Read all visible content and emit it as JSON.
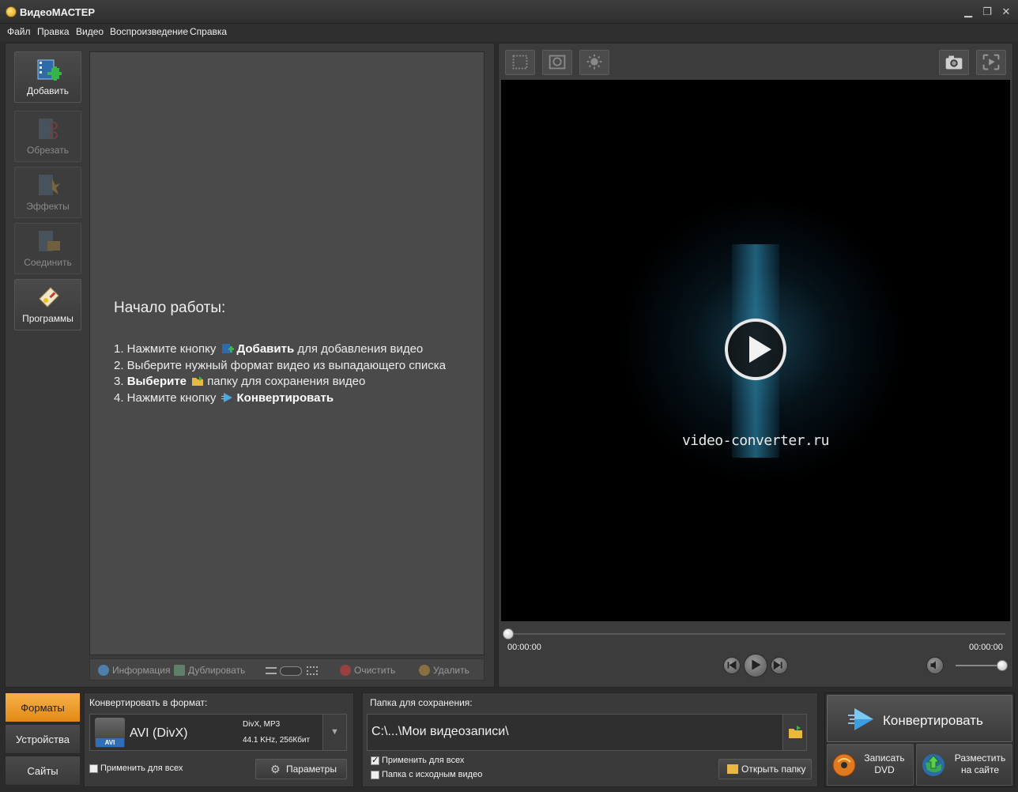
{
  "window": {
    "title": "ВидеоМАСТЕР",
    "min": "▁",
    "restore": "❐",
    "close": "✕"
  },
  "menu": [
    "Файл",
    "Правка",
    "Видео",
    "Воспроизведение",
    "Справка"
  ],
  "tools": [
    {
      "label": "Добавить",
      "enabled": true,
      "icon": "film-add-icon"
    },
    {
      "label": "Обрезать",
      "enabled": false,
      "icon": "scissors-icon"
    },
    {
      "label": "Эффекты",
      "enabled": false,
      "icon": "effects-icon"
    },
    {
      "label": "Соединить",
      "enabled": false,
      "icon": "join-icon"
    },
    {
      "label": "Программы",
      "enabled": true,
      "icon": "programs-icon"
    }
  ],
  "guide": {
    "title": "Начало работы:",
    "step1_pre": "1. Нажмите кнопку",
    "step1_bold": "Добавить",
    "step1_post": "для добавления видео",
    "step2": "2. Выберите нужный формат видео из выпадающего списка",
    "step3_pre": "3.",
    "step3_bold": "Выберите",
    "step3_post": "папку для сохранения видео",
    "step4_pre": "4. Нажмите кнопку",
    "step4_bold": "Конвертировать"
  },
  "listbar": {
    "info": "Информация",
    "duplicate": "Дублировать",
    "clear": "Очистить",
    "delete": "Удалить"
  },
  "preview": {
    "brand": "video-converter.ru",
    "time_start": "00:00:00",
    "time_end": "00:00:00",
    "progress": 0,
    "volume": 1.0
  },
  "tabs": [
    {
      "label": "Форматы",
      "active": true
    },
    {
      "label": "Устройства",
      "active": false
    },
    {
      "label": "Сайты",
      "active": false
    }
  ],
  "format": {
    "header": "Конвертировать в формат:",
    "badge": "AVI",
    "name": "AVI (DivX)",
    "spec1": "DivX, MP3",
    "spec2": "44.1 KHz, 256Кбит",
    "dropdown": "▼",
    "apply_all": "Применить для всех",
    "apply_all_checked": false,
    "params": "Параметры"
  },
  "save": {
    "header": "Папка для сохранения:",
    "path": "C:\\...\\Мои видеозаписи\\",
    "apply_all": "Применить для всех",
    "apply_all_checked": true,
    "source_folder": "Папка с исходным видео",
    "source_folder_checked": false,
    "open_folder": "Открыть папку"
  },
  "actions": {
    "convert": "Конвертировать",
    "dvd_line1": "Записать",
    "dvd_line2": "DVD",
    "upload_line1": "Разместить",
    "upload_line2": "на сайте"
  },
  "colors": {
    "accent": "#f0a030",
    "bg": "#2b2b2b",
    "panel": "#3a3a3a",
    "link_blue": "#2f6fb8"
  }
}
